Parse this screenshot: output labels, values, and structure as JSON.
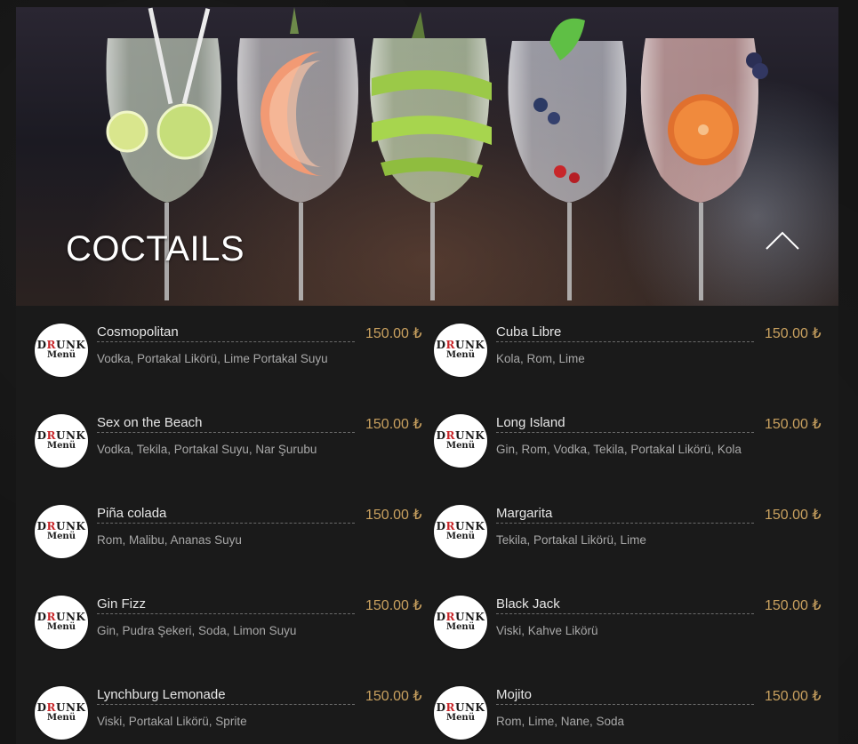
{
  "hero": {
    "title": "COCTAILS"
  },
  "logo": {
    "line1_a": "D",
    "line1_r": "R",
    "line1_b": "UNK",
    "line2": "Menü"
  },
  "colors": {
    "price": "#c9a15f",
    "name": "#e6e6e6",
    "description": "#a8a8a8",
    "background": "#151515"
  },
  "items": [
    {
      "name": "Cosmopolitan",
      "price": "150.00 ₺",
      "description": "Vodka, Portakal Likörü, Lime Portakal Suyu"
    },
    {
      "name": "Cuba Libre",
      "price": "150.00 ₺",
      "description": "Kola, Rom, Lime"
    },
    {
      "name": "Sex on the Beach",
      "price": "150.00 ₺",
      "description": "Vodka, Tekila, Portakal Suyu, Nar Şurubu"
    },
    {
      "name": "Long Island",
      "price": "150.00 ₺",
      "description": "Gin, Rom, Vodka, Tekila, Portakal Likörü, Kola"
    },
    {
      "name": "Piña colada",
      "price": "150.00 ₺",
      "description": "Rom, Malibu, Ananas Suyu"
    },
    {
      "name": "Margarita",
      "price": "150.00 ₺",
      "description": "Tekila, Portakal Likörü, Lime"
    },
    {
      "name": "Gin Fizz",
      "price": "150.00 ₺",
      "description": "Gin, Pudra Şekeri, Soda, Limon Suyu"
    },
    {
      "name": "Black Jack",
      "price": "150.00 ₺",
      "description": "Viski, Kahve Likörü"
    },
    {
      "name": "Lynchburg Lemonade",
      "price": "150.00 ₺",
      "description": "Viski, Portakal Likörü, Sprite"
    },
    {
      "name": "Mojito",
      "price": "150.00 ₺",
      "description": "Rom, Lime, Nane, Soda"
    }
  ]
}
